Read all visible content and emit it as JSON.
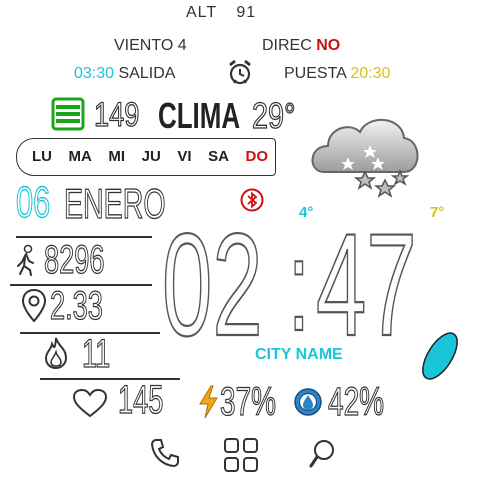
{
  "top": {
    "alt_label": "ALT",
    "alt_value": "91"
  },
  "wind": {
    "speed_label": "VIENTO",
    "speed_value": "4",
    "dir_label": "DIREC",
    "dir_value": "NO"
  },
  "sun": {
    "sunrise_time": "03:30",
    "sunrise_label": "SALIDA",
    "sunset_label": "PUESTA",
    "sunset_time": "20:30"
  },
  "row3": {
    "icon": "stack-icon",
    "steps_small": "149",
    "clima_label": "CLIMA",
    "temp": "29°"
  },
  "weekdays": [
    "LU",
    "MA",
    "MI",
    "JU",
    "VI",
    "SA",
    "DO"
  ],
  "date": {
    "day": "06",
    "month": "ENERO"
  },
  "temps": {
    "low": "4°",
    "high": "7°"
  },
  "time": {
    "hours": "02",
    "minutes": "47",
    "separator": ":"
  },
  "city": "CITY NAME",
  "stats": {
    "steps": "8296",
    "distance": "2.33",
    "calories": "11",
    "heart": "145"
  },
  "battery": {
    "icon": "bolt-icon",
    "value": "37",
    "unit": "%"
  },
  "humidity": {
    "icon": "humidity-icon",
    "value": "42",
    "unit": "%"
  },
  "bottom": {
    "left_icon": "phone-icon",
    "center_icon": "apps-icon",
    "right_icon": "search-icon"
  },
  "colors": {
    "accent_cyan": "#19c6d9",
    "accent_red": "#cc1111",
    "accent_yellow": "#f0c419",
    "accent_green": "#1aa51a"
  }
}
